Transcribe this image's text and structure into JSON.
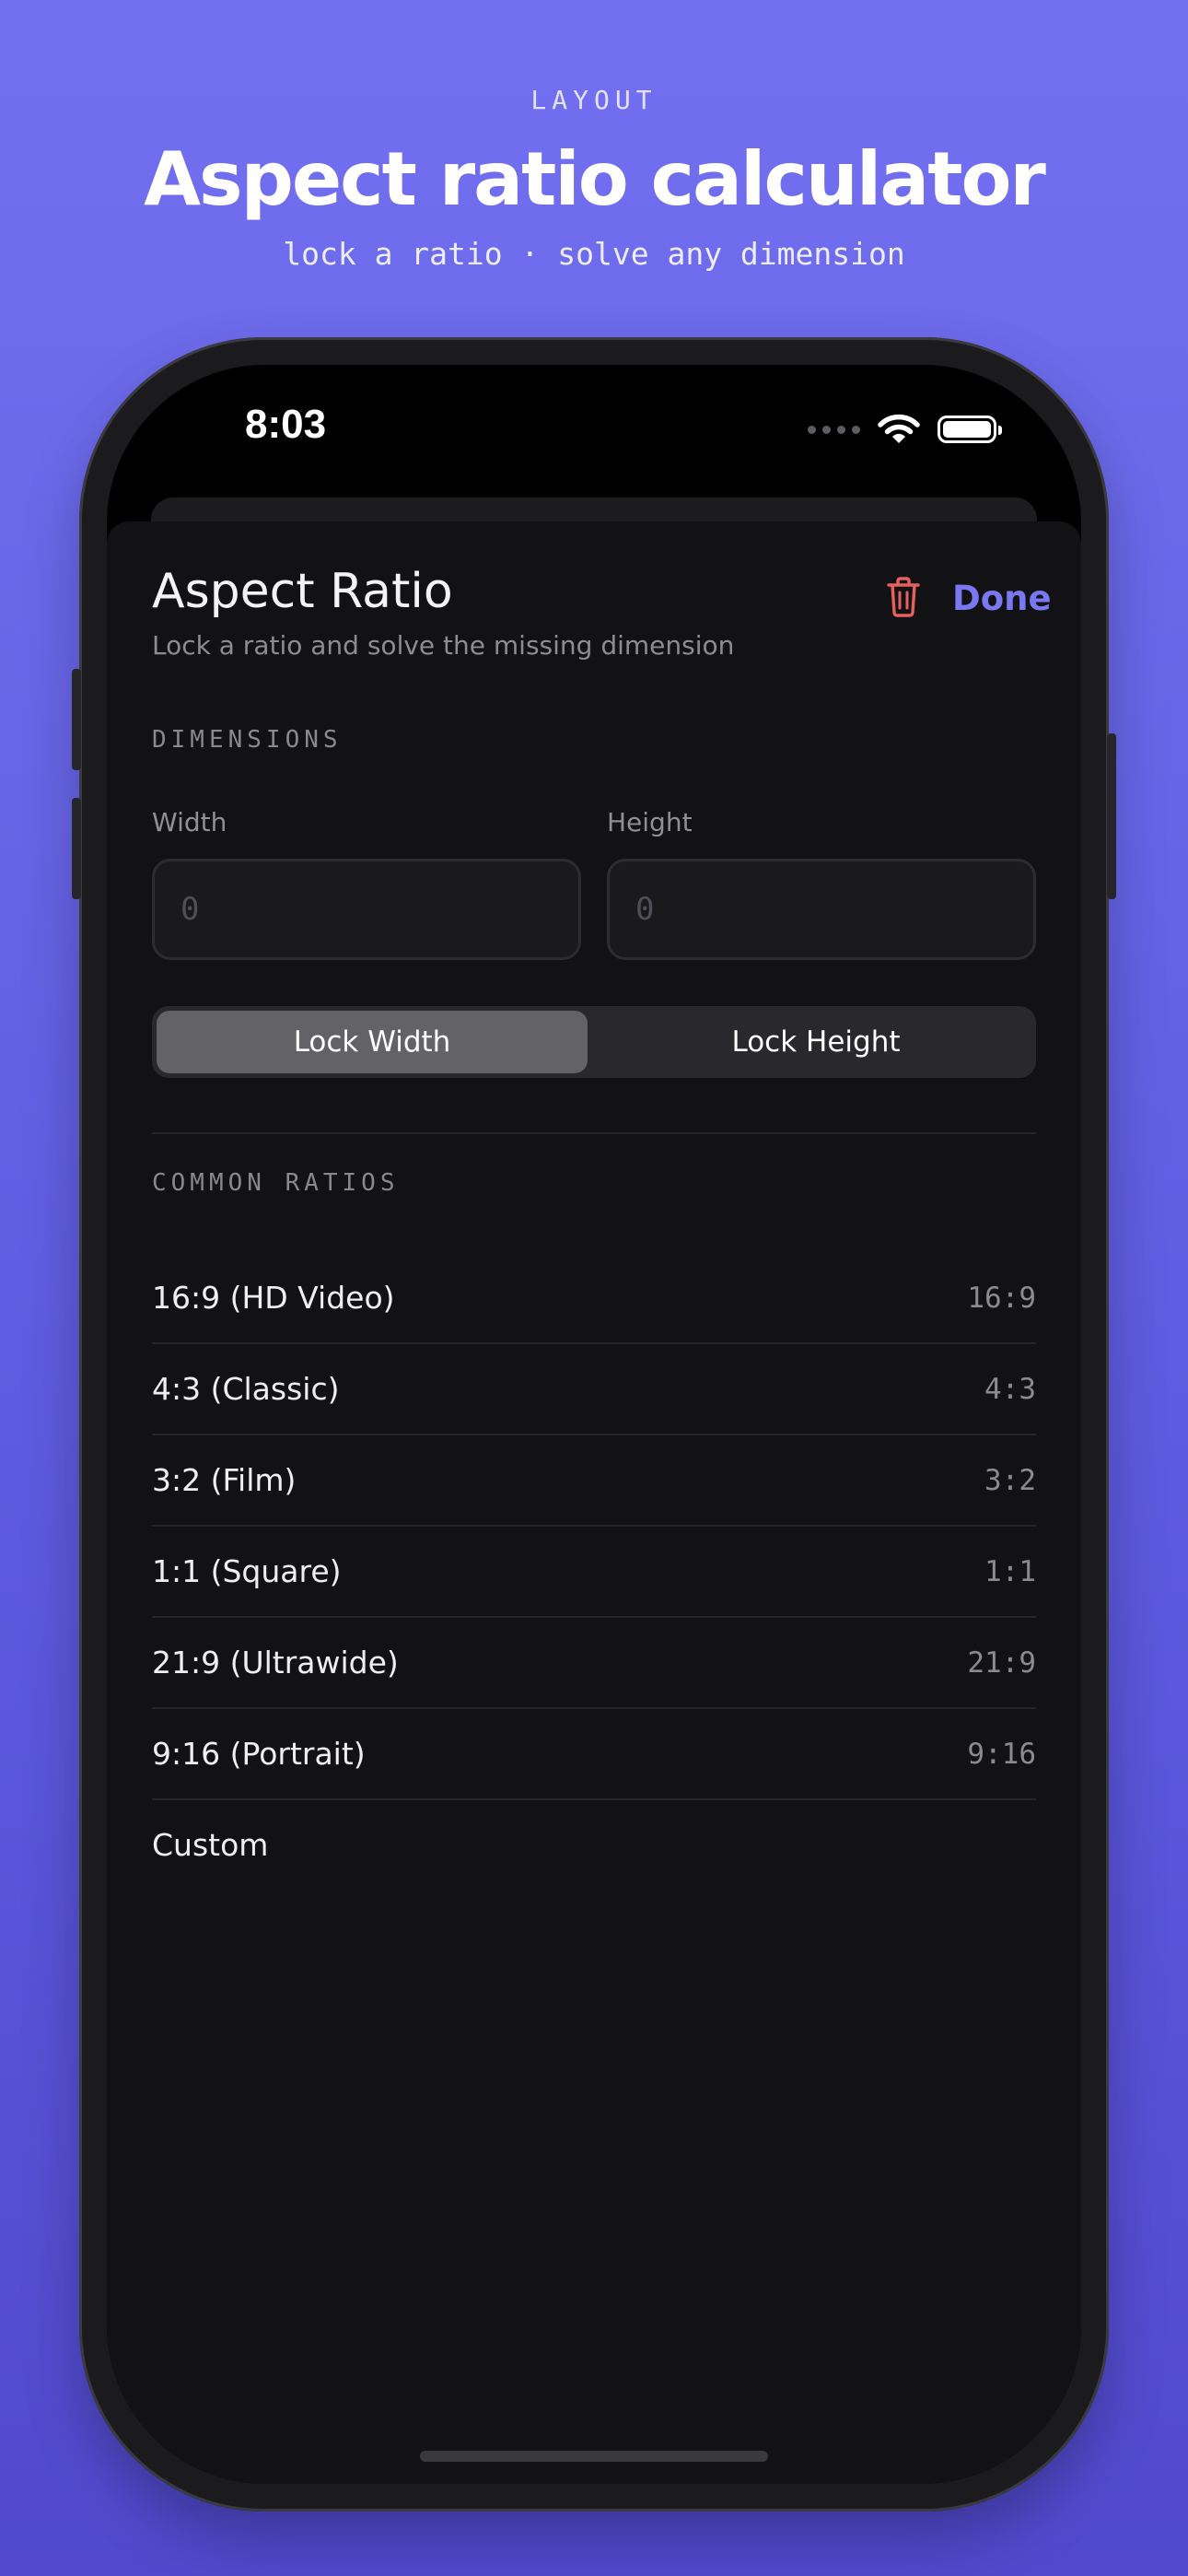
{
  "hero": {
    "eyebrow": "LAYOUT",
    "title": "Aspect ratio calculator",
    "tagline": "lock a ratio · solve any dimension"
  },
  "status_bar": {
    "time": "8:03"
  },
  "sheet": {
    "title": "Aspect Ratio",
    "subtitle": "Lock a ratio and solve the missing dimension",
    "done_label": "Done"
  },
  "dimensions": {
    "section_label": "DIMENSIONS",
    "width_label": "Width",
    "height_label": "Height",
    "width_placeholder": "0",
    "height_placeholder": "0",
    "width_value": "",
    "height_value": ""
  },
  "lock": {
    "width_label": "Lock Width",
    "height_label": "Lock Height",
    "selected": "width"
  },
  "ratios": {
    "section_label": "COMMON RATIOS",
    "items": [
      {
        "name": "16:9 (HD Video)",
        "value": "16:9"
      },
      {
        "name": "4:3 (Classic)",
        "value": "4:3"
      },
      {
        "name": "3:2 (Film)",
        "value": "3:2"
      },
      {
        "name": "1:1 (Square)",
        "value": "1:1"
      },
      {
        "name": "21:9 (Ultrawide)",
        "value": "21:9"
      },
      {
        "name": "9:16 (Portrait)",
        "value": "9:16"
      },
      {
        "name": "Custom",
        "value": ""
      }
    ]
  },
  "colors": {
    "accent": "#7a77f2",
    "destructive": "#e5605f",
    "background": "#121214"
  }
}
